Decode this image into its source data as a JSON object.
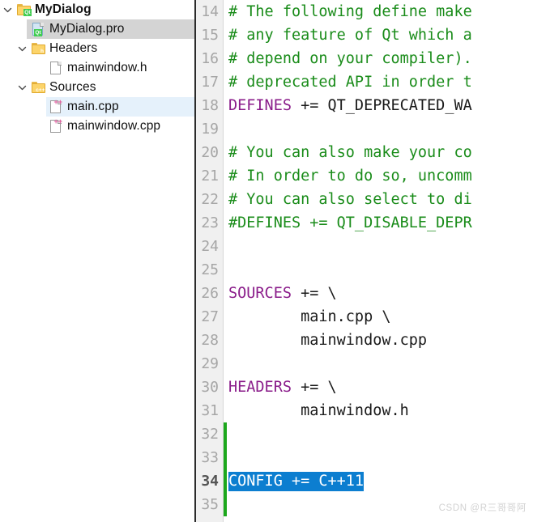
{
  "project_tree": {
    "name": "project-tree",
    "rows": [
      {
        "label": "MyDialog",
        "icon": "qt-project-folder-icon",
        "twisty": "chevron-down-icon",
        "indent": 0,
        "bold": true,
        "state": "expanded",
        "selected": false,
        "hovered": false
      },
      {
        "label": "MyDialog.pro",
        "icon": "qt-pro-file-icon",
        "twisty": "none",
        "indent": 1,
        "bold": false,
        "state": "leaf",
        "selected": true,
        "hovered": false
      },
      {
        "label": "Headers",
        "icon": "headers-folder-icon",
        "twisty": "chevron-down-icon",
        "indent": 1,
        "bold": false,
        "state": "expanded",
        "selected": false,
        "hovered": false
      },
      {
        "label": "mainwindow.h",
        "icon": "header-file-icon",
        "twisty": "none",
        "indent": 2,
        "bold": false,
        "state": "leaf",
        "selected": false,
        "hovered": false
      },
      {
        "label": "Sources",
        "icon": "sources-folder-icon",
        "twisty": "chevron-down-icon",
        "indent": 1,
        "bold": false,
        "state": "expanded",
        "selected": false,
        "hovered": false
      },
      {
        "label": "main.cpp",
        "icon": "cpp-file-icon",
        "twisty": "none",
        "indent": 2,
        "bold": false,
        "state": "leaf",
        "selected": false,
        "hovered": true
      },
      {
        "label": "mainwindow.cpp",
        "icon": "cpp-file-icon",
        "twisty": "none",
        "indent": 2,
        "bold": false,
        "state": "leaf",
        "selected": false,
        "hovered": false
      }
    ]
  },
  "editor": {
    "name": "qmake-project-file-editor",
    "current_line": 34,
    "first_visible_line": 14,
    "change_marker_from_line": 32,
    "change_marker_to_line": 35,
    "lines": [
      {
        "no": "14",
        "segments": [
          {
            "text": "# The following define make",
            "type": "comment"
          }
        ]
      },
      {
        "no": "15",
        "segments": [
          {
            "text": "# any feature of Qt which a",
            "type": "comment"
          }
        ]
      },
      {
        "no": "16",
        "segments": [
          {
            "text": "# depend on your compiler).",
            "type": "comment"
          }
        ]
      },
      {
        "no": "17",
        "segments": [
          {
            "text": "# deprecated API in order t",
            "type": "comment"
          }
        ]
      },
      {
        "no": "18",
        "segments": [
          {
            "text": "DEFINES",
            "type": "var"
          },
          {
            "text": " += QT_DEPRECATED_WA",
            "type": "plain"
          }
        ]
      },
      {
        "no": "19",
        "segments": []
      },
      {
        "no": "20",
        "segments": [
          {
            "text": "# You can also make your co",
            "type": "comment"
          }
        ]
      },
      {
        "no": "21",
        "segments": [
          {
            "text": "# In order to do so, uncomm",
            "type": "comment"
          }
        ]
      },
      {
        "no": "22",
        "segments": [
          {
            "text": "# You can also select to di",
            "type": "comment"
          }
        ]
      },
      {
        "no": "23",
        "segments": [
          {
            "text": "#DEFINES += QT_DISABLE_DEPR",
            "type": "comment"
          }
        ]
      },
      {
        "no": "24",
        "segments": []
      },
      {
        "no": "25",
        "segments": []
      },
      {
        "no": "26",
        "segments": [
          {
            "text": "SOURCES",
            "type": "var"
          },
          {
            "text": " += \\",
            "type": "plain"
          }
        ]
      },
      {
        "no": "27",
        "segments": [
          {
            "text": "        main.cpp \\",
            "type": "plain"
          }
        ]
      },
      {
        "no": "28",
        "segments": [
          {
            "text": "        mainwindow.cpp",
            "type": "plain"
          }
        ]
      },
      {
        "no": "29",
        "segments": []
      },
      {
        "no": "30",
        "segments": [
          {
            "text": "HEADERS",
            "type": "var"
          },
          {
            "text": " += \\",
            "type": "plain"
          }
        ]
      },
      {
        "no": "31",
        "segments": [
          {
            "text": "        mainwindow.h",
            "type": "plain"
          }
        ]
      },
      {
        "no": "32",
        "segments": []
      },
      {
        "no": "33",
        "segments": []
      },
      {
        "no": "34",
        "segments": [
          {
            "text": "CONFIG += C++11",
            "type": "plain",
            "selected": true
          }
        ]
      },
      {
        "no": "35",
        "segments": []
      }
    ]
  },
  "watermark": {
    "text": "CSDN @R三哥哥阿"
  },
  "colors": {
    "comment": "#1a8c1a",
    "variable": "#8a1c8a",
    "selection_bg": "#0c7ed0",
    "selection_fg": "#ffffff",
    "gutter_bg": "#f0f0f0",
    "lineno": "#a6a6a6",
    "change_marker": "#1ca81c",
    "tree_selected_bg": "#d4d4d4",
    "tree_hover_bg": "#e5f1fb",
    "splitter": "#2b2b2b"
  }
}
